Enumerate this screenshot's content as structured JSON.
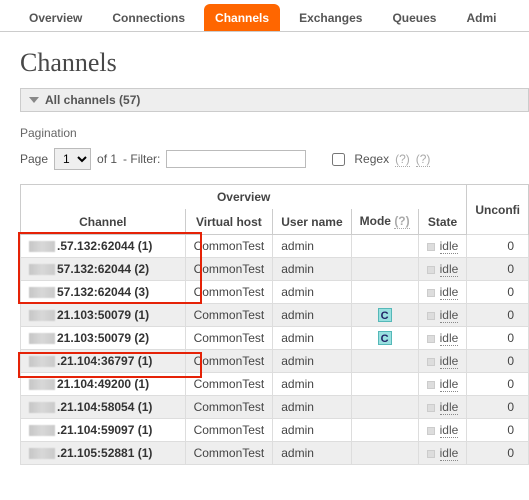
{
  "nav": {
    "tabs": [
      "Overview",
      "Connections",
      "Channels",
      "Exchanges",
      "Queues",
      "Admi"
    ],
    "active": 2
  },
  "page_title": "Channels",
  "section_hdr": "All channels (57)",
  "pagination": {
    "label": "Pagination",
    "page_lbl": "Page",
    "page_val": "1",
    "of_lbl": "of 1",
    "filter_lbl": "- Filter:",
    "filter_val": "",
    "regex_lbl": "Regex",
    "help": "(?)",
    "help2": "(?)"
  },
  "headers": {
    "group": "Overview",
    "channel": "Channel",
    "vhost": "Virtual host",
    "user": "User name",
    "mode": "Mode",
    "mode_help": "(?)",
    "state": "State",
    "unconf": "Unconfi"
  },
  "rows": [
    {
      "ch": ".57.132:62044 (1)",
      "vhost": "CommonTest",
      "user": "admin",
      "mode": "",
      "state": "idle",
      "unconf": "0"
    },
    {
      "ch": "57.132:62044 (2)",
      "vhost": "CommonTest",
      "user": "admin",
      "mode": "",
      "state": "idle",
      "unconf": "0"
    },
    {
      "ch": "57.132:62044 (3)",
      "vhost": "CommonTest",
      "user": "admin",
      "mode": "",
      "state": "idle",
      "unconf": "0"
    },
    {
      "ch": "21.103:50079 (1)",
      "vhost": "CommonTest",
      "user": "admin",
      "mode": "C",
      "state": "idle",
      "unconf": "0"
    },
    {
      "ch": "21.103:50079 (2)",
      "vhost": "CommonTest",
      "user": "admin",
      "mode": "C",
      "state": "idle",
      "unconf": "0"
    },
    {
      "ch": ".21.104:36797 (1)",
      "vhost": "CommonTest",
      "user": "admin",
      "mode": "",
      "state": "idle",
      "unconf": "0"
    },
    {
      "ch": "21.104:49200 (1)",
      "vhost": "CommonTest",
      "user": "admin",
      "mode": "",
      "state": "idle",
      "unconf": "0"
    },
    {
      "ch": ".21.104:58054 (1)",
      "vhost": "CommonTest",
      "user": "admin",
      "mode": "",
      "state": "idle",
      "unconf": "0"
    },
    {
      "ch": ".21.104:59097 (1)",
      "vhost": "CommonTest",
      "user": "admin",
      "mode": "",
      "state": "idle",
      "unconf": "0"
    },
    {
      "ch": ".21.105:52881 (1)",
      "vhost": "CommonTest",
      "user": "admin",
      "mode": "",
      "state": "idle",
      "unconf": "0"
    }
  ]
}
